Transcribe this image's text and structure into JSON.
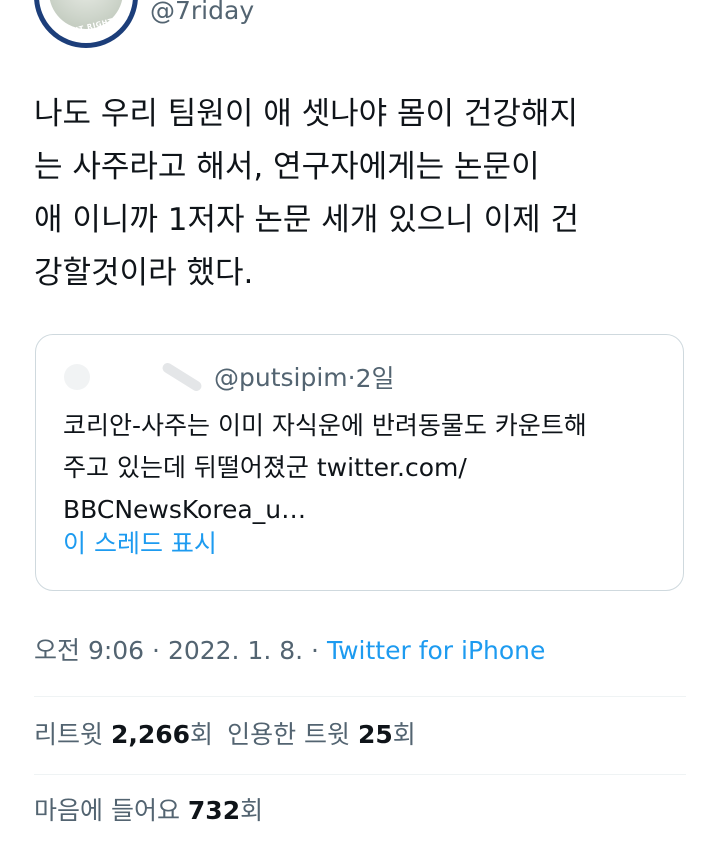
{
  "author": {
    "handle": "@7riday",
    "avatar_ring_text": "RIGHT RIGHT NOW"
  },
  "tweet": {
    "text": "나도 우리 팀원이 애 셋나야 몸이 건강해지\n는 사주라고 해서, 연구자에게는 논문이\n애 이니까 1저자 논문 세개 있으니 이제 건\n강할것이라 했다."
  },
  "quote": {
    "handle": "@putsipim",
    "separator": "·",
    "time": "2일",
    "text": "코리안-사주는 이미 자식운에 반려동물도 카운트해\n주고 있는데 뒤떨어졌군 twitter.com/\nBBCNewsKorea_u…",
    "show_thread": "이 스레드 표시"
  },
  "meta": {
    "time": "오전 9:06",
    "sep1": " · ",
    "date": "2022. 1. 8.",
    "sep2": " · ",
    "source": "Twitter for iPhone"
  },
  "stats": {
    "retweets_label": "리트윗",
    "retweets_count": "2,266",
    "retweets_unit": "회",
    "quotes_label": "인용한 트윗",
    "quotes_count": "25",
    "quotes_unit": "회",
    "likes_label": "마음에 들어요",
    "likes_count": "732",
    "likes_unit": "회"
  },
  "colors": {
    "accent": "#1d9bf0",
    "secondary_text": "#536471",
    "primary_text": "#0f1419",
    "border": "#cfd9de"
  }
}
